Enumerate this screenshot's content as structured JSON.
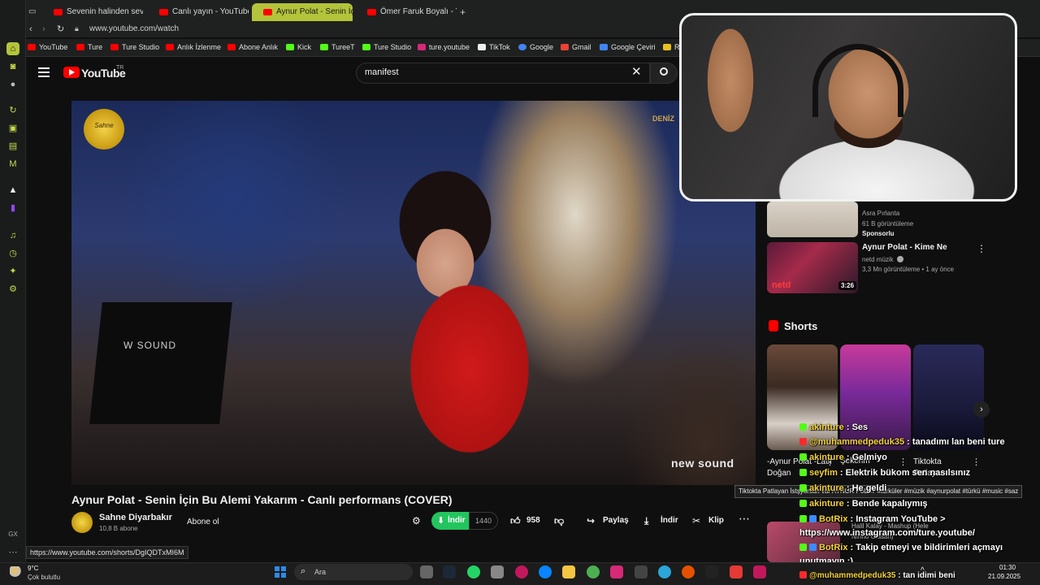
{
  "browser": {
    "tabs": [
      {
        "label": "Sevenin halinden sevenler",
        "active": false
      },
      {
        "label": "Canlı yayın - YouTube Stu",
        "active": false
      },
      {
        "label": "Aynur Polat - Senin İç",
        "active": true
      },
      {
        "label": "Ömer Faruk Boyalı - YouT",
        "active": false
      }
    ],
    "url": "www.youtube.com/watch",
    "bookmarks": [
      "YouTube",
      "Ture",
      "Ture Studio",
      "Anlık İzlenme",
      "Abone Anlık",
      "Kick",
      "TureeT",
      "Ture Studio",
      "ture.youtube",
      "TikTok",
      "Google",
      "Gmail",
      "Google Çeviri",
      "R"
    ],
    "status_url": "https://www.youtube.com/shorts/DgIQDTxMI6M",
    "sidebar_label": "GX"
  },
  "youtube": {
    "logo_text": "YouTube",
    "logo_region": "TR",
    "search_value": "manifest"
  },
  "player": {
    "badge_text": "Sahne",
    "corner_text": "DENİZ",
    "watermark": "new sound",
    "stand_text": "W SOUND"
  },
  "video": {
    "title": "Aynur Polat - Senin İçin Bu Alemi Yakarım - Canlı performans (COVER)",
    "channel": "Sahne Diyarbakır",
    "subscribers": "10,8 B abone",
    "subscribe_label": "Abone ol",
    "ext_download_label": "İndir",
    "ext_download_count": "1440",
    "likes": "958",
    "share_label": "Paylaş",
    "download_label": "İndir",
    "clip_label": "Klip"
  },
  "recommendations": {
    "rec1": {
      "channel": "Asra Pırlanta",
      "views": "61 B görüntüleme",
      "sponsored": "Sponsorlu"
    },
    "rec2": {
      "title": "Aynur Polat - Kime Ne",
      "channel": "netd müzik",
      "meta": "3,3 Mn görüntüleme • 1 ay önce",
      "duration": "3:26",
      "logo": "netd"
    },
    "shorts_heading": "Shorts",
    "shorts": [
      {
        "title": "-Aynur Polat -Latif Doğan"
      },
      {
        "title": "Şekerim"
      },
      {
        "title": "Tiktokta Patlayan"
      }
    ],
    "tooltip": "Tiktokta Patlayan İstşyorsan var AYNUR PoLAT #türküler #müzik #aynurpolat #türkü #music #saz",
    "rec3": {
      "title": "Halil Kalay - Mashup (Hele",
      "sub": "Nînno Olasan)"
    }
  },
  "chat": [
    {
      "user": "akinture",
      "text": "Ses",
      "badge": "kick"
    },
    {
      "user": "@muhammedpeduk35",
      "text": "tanadımı lan beni ture",
      "badge": "yt"
    },
    {
      "user": "akinture",
      "text": "Gelmiyo",
      "badge": "kick"
    },
    {
      "user": "seyfim",
      "text": "Elektrik bükom sen nasılsınız",
      "badge": "kick"
    },
    {
      "user": "akinture",
      "text": "He geldi",
      "badge": "kick"
    },
    {
      "user": "akinture",
      "text": "Bende kapalıymış",
      "badge": "kick"
    },
    {
      "user": "BotRix",
      "text": "Instagram YouTube >",
      "badge": "kick"
    },
    {
      "user": "",
      "text": "https://www.instagram.com/ture.youtube/",
      "badge": ""
    },
    {
      "user": "BotRix",
      "text": "Takip etmeyi ve bildirimleri açmayı",
      "badge": "kick"
    },
    {
      "user": "",
      "text": "unutmayın :)",
      "badge": ""
    },
    {
      "user": "@muhammedpeduk35",
      "text": "tan idimi beni",
      "badge": "yt"
    }
  ],
  "taskbar": {
    "temp": "9°C",
    "weather": "Çok bulutlu",
    "search_placeholder": "Ara",
    "time": "01:30",
    "date": "21.09.2025"
  },
  "colors": {
    "accent": "#b3c43a",
    "youtube_red": "#ff0000",
    "kick_green": "#53fc18",
    "ext_green": "#22c55e",
    "chat_user": "#f5d33a"
  }
}
